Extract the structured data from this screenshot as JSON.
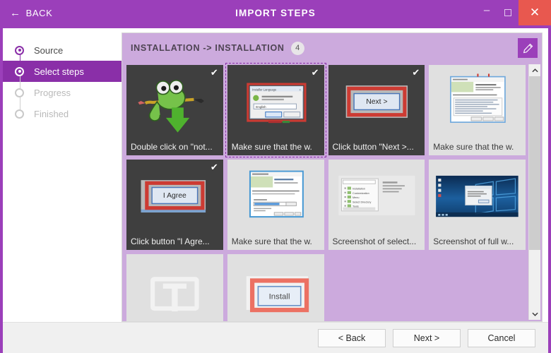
{
  "window": {
    "back_label": "BACK",
    "title": "IMPORT STEPS",
    "minimize_label": "–",
    "maximize_label": "",
    "close_label": "✕",
    "accent_color": "#9b3fba",
    "close_color": "#e8584f"
  },
  "sidebar": {
    "steps": [
      {
        "label": "Source",
        "state": "done"
      },
      {
        "label": "Select steps",
        "state": "active"
      },
      {
        "label": "Progress",
        "state": "inactive"
      },
      {
        "label": "Finished",
        "state": "inactive"
      }
    ]
  },
  "panel": {
    "breadcrumb": "INSTALLATION -> INSTALLATION",
    "badge_count": "4",
    "edit_icon": "pencil-icon",
    "header_color": "#ccaadd"
  },
  "cards": [
    {
      "caption": "Double click on \"not...",
      "selected": true,
      "checked": true,
      "focused": false,
      "art": "chameleon-download"
    },
    {
      "caption": "Make sure that the w.",
      "selected": true,
      "checked": true,
      "focused": true,
      "art": "language-dialog"
    },
    {
      "caption": "Click button \"Next >...",
      "selected": true,
      "checked": true,
      "focused": false,
      "art": "next-button"
    },
    {
      "caption": "Make sure that the w.",
      "selected": false,
      "checked": false,
      "focused": false,
      "art": "license-window"
    },
    {
      "caption": "Click button \"I Agre...",
      "selected": true,
      "checked": true,
      "focused": false,
      "art": "iagree-button"
    },
    {
      "caption": "Make sure that the w.",
      "selected": false,
      "checked": false,
      "focused": false,
      "art": "progress-window"
    },
    {
      "caption": "Screenshot of select...",
      "selected": false,
      "checked": false,
      "focused": false,
      "art": "tree-select"
    },
    {
      "caption": "Screenshot of full w...",
      "selected": false,
      "checked": false,
      "focused": false,
      "art": "desktop-full"
    },
    {
      "caption": "",
      "selected": false,
      "checked": false,
      "focused": false,
      "art": "placeholder"
    },
    {
      "caption": "",
      "selected": false,
      "checked": false,
      "focused": false,
      "art": "install-button"
    }
  ],
  "thumbs": {
    "language_title": "Installer Language",
    "language_prompt": "Please select a language.",
    "language_value": "English",
    "next_button_label": "Next >",
    "iagree_button_label": "I Agree",
    "install_button_label": "Install"
  },
  "scrollbar": {
    "up_arrow": "ⱏ",
    "down_arrow": "ⱟ",
    "thumb_percent": "75"
  },
  "footer": {
    "back": "< Back",
    "next": "Next >",
    "cancel": "Cancel"
  }
}
